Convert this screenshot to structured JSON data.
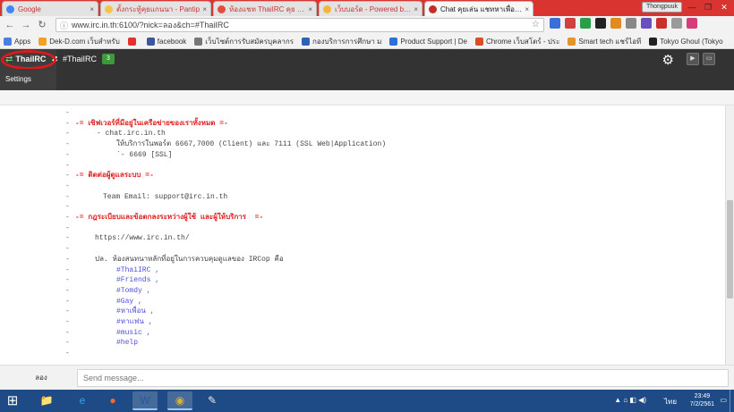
{
  "browser": {
    "tabs": [
      {
        "title": "Google",
        "favicon_color": "#4285f4",
        "active": false
      },
      {
        "title": "ตั้งกระทู้คุยแกนนา - Pantip",
        "favicon_color": "#f6c643",
        "active": false
      },
      {
        "title": "ห้องแชท ThaiIRC คุย แชท เพื่อนคุย",
        "favicon_color": "#e44d3a",
        "active": false
      },
      {
        "title": "เว็บบอร์ด - Powered by Dek-D",
        "favicon_color": "#f3b63b",
        "active": false
      },
      {
        "title": "Chat คุยเล่น แชทหาเพื่อน แชท",
        "favicon_color": "#c0302a",
        "active": true
      }
    ],
    "user_label": "Thongpuuk",
    "window_controls": {
      "minimize": "—",
      "maximize": "❐",
      "close": "✕"
    },
    "url": "www.irc.in.th:6100/?nick=ลอง&ch=#ThaiIRC",
    "bookmarks": [
      {
        "label": "Apps",
        "icon_color": "#4a7ee0"
      },
      {
        "label": "Dek-D.com เว็บสำหรับ",
        "icon_color": "#f0a321"
      },
      {
        "label": "",
        "icon_color": "#e5302c"
      },
      {
        "label": "facebook",
        "icon_color": "#3b5998"
      },
      {
        "label": "เว็บไซต์การรับสมัครบุคลากร",
        "icon_color": "#777777"
      },
      {
        "label": "กองบริการการศึกษา ม",
        "icon_color": "#2c63b5"
      },
      {
        "label": "Product Support | De",
        "icon_color": "#2f6fd8"
      },
      {
        "label": "Chrome เว็บสโตร์ - ประ",
        "icon_color": "#d94d2c"
      },
      {
        "label": "Smart tech แชร์ไอที",
        "icon_color": "#e8922a"
      },
      {
        "label": "Tokyo Ghoul (Tokyo",
        "icon_color": "#222222"
      }
    ]
  },
  "app": {
    "tab_main": "ThaiIRC",
    "tab_channel": "#ThaiIRC",
    "channel_badge": "3",
    "settings_label": "Settings",
    "gear_glyph": "⚙",
    "accent": "#e02020"
  },
  "messages": [
    {
      "dash": "-",
      "text": "",
      "indent": 0,
      "style": "plain"
    },
    {
      "dash": "-",
      "text": "-= เซิฟเวอร์ที่มีอยู่ในเครือข่ายของเราทั้งหมด =-",
      "indent": 84,
      "style": "red"
    },
    {
      "dash": "-",
      "text": "- chat.irc.in.th",
      "indent": 108,
      "style": "plain"
    },
    {
      "dash": "-",
      "text": "ให้บริการในพอร์ต 6667,7000 (Client) และ 7111 (SSL Web|Application)",
      "indent": 130,
      "style": "plain"
    },
    {
      "dash": "-",
      "text": "`- 6669 [SSL]",
      "indent": 130,
      "style": "plain"
    },
    {
      "dash": "-",
      "text": "",
      "indent": 0,
      "style": "plain"
    },
    {
      "dash": "-",
      "text": "-= ติดต่อผู้ดูแลระบบ =-",
      "indent": 84,
      "style": "red"
    },
    {
      "dash": "-",
      "text": "",
      "indent": 0,
      "style": "plain"
    },
    {
      "dash": "-",
      "text": "Team Email: support@irc.in.th",
      "indent": 115,
      "style": "plain"
    },
    {
      "dash": "-",
      "text": "",
      "indent": 0,
      "style": "plain"
    },
    {
      "dash": "-",
      "text": "-= กฎระเบียบและข้อตกลงระหว่างผู้ใช้ และผู้ให้บริการ  =-",
      "indent": 84,
      "style": "red"
    },
    {
      "dash": "-",
      "text": "",
      "indent": 0,
      "style": "plain"
    },
    {
      "dash": "-",
      "text": "https://www.irc.in.th/",
      "indent": 106,
      "style": "plain"
    },
    {
      "dash": "-",
      "text": "",
      "indent": 0,
      "style": "plain"
    },
    {
      "dash": "-",
      "text": "ปล. ห้องสนทนาหลักที่อยู่ในการควบคุมดูแลของ IRCop คือ",
      "indent": 106,
      "style": "plain"
    },
    {
      "dash": "-",
      "text": "#ThaiIRC ,",
      "indent": 130,
      "style": "link"
    },
    {
      "dash": "-",
      "text": "#Friends ,",
      "indent": 130,
      "style": "link"
    },
    {
      "dash": "-",
      "text": "#Tomdy ,",
      "indent": 130,
      "style": "link"
    },
    {
      "dash": "-",
      "text": "#Gay ,",
      "indent": 130,
      "style": "link"
    },
    {
      "dash": "-",
      "text": "#หาเพื่อน ,",
      "indent": 130,
      "style": "link"
    },
    {
      "dash": "-",
      "text": "#หาแฟน ,",
      "indent": 130,
      "style": "link"
    },
    {
      "dash": "-",
      "text": "#music ,",
      "indent": 130,
      "style": "link"
    },
    {
      "dash": "-",
      "text": "#help",
      "indent": 130,
      "style": "link"
    },
    {
      "dash": "-",
      "text": "",
      "indent": 0,
      "style": "plain"
    }
  ],
  "composer": {
    "nick": "ลอง",
    "placeholder": "Send message..."
  },
  "taskbar": {
    "apps": [
      {
        "name": "file-explorer",
        "glyph": "📁",
        "color": "#f5c04a",
        "active": false
      },
      {
        "name": "internet-explorer",
        "glyph": "e",
        "color": "#3aa0e8",
        "active": false
      },
      {
        "name": "firefox",
        "glyph": "●",
        "color": "#e8702a",
        "active": false
      },
      {
        "name": "word",
        "glyph": "W",
        "color": "#2b579a",
        "active": true
      },
      {
        "name": "chrome",
        "glyph": "◉",
        "color": "#e0b030",
        "active": true
      },
      {
        "name": "paint",
        "glyph": "✎",
        "color": "#e8e8e8",
        "active": false
      }
    ],
    "language": "ไทย",
    "time": "23:49",
    "date": "7/2/2561"
  }
}
